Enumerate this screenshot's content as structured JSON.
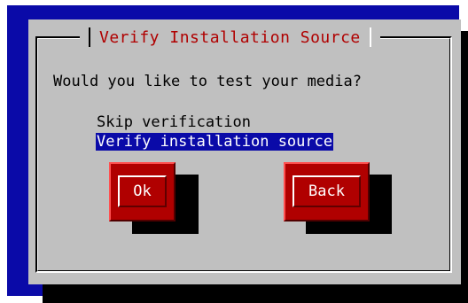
{
  "dialog": {
    "title": "Verify Installation Source",
    "question": "Would you like to test your media?",
    "options": [
      {
        "label": "Skip verification",
        "selected": false
      },
      {
        "label": "Verify installation source",
        "selected": true
      }
    ],
    "buttons": {
      "ok": "Ok",
      "back": "Back"
    }
  },
  "colors": {
    "background": "#0a0aa8",
    "dialog": "#c0c0c0",
    "title": "#b00000",
    "button": "#b00000",
    "highlight": "#0a0aa8"
  }
}
